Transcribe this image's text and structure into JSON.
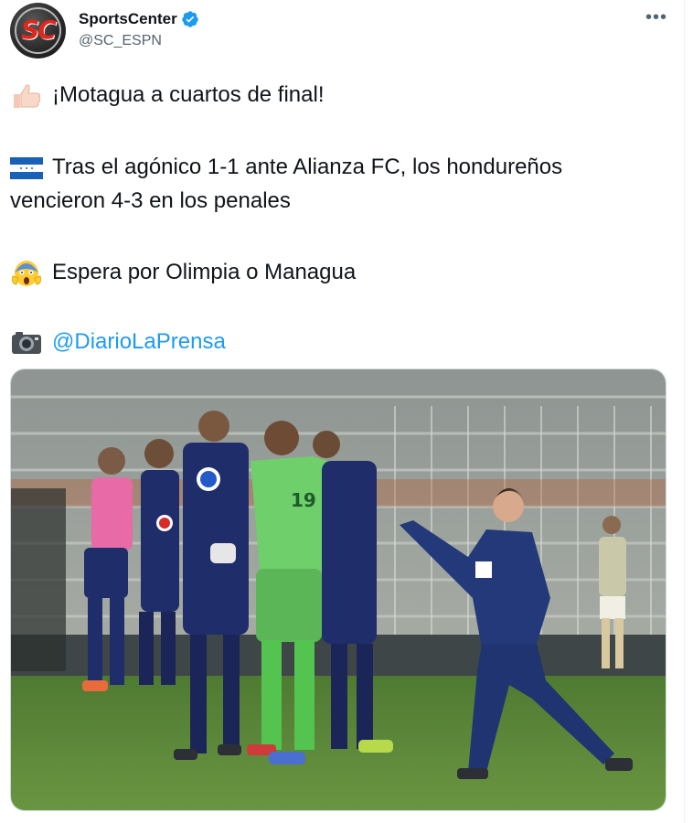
{
  "account": {
    "name": "SportsCenter",
    "handle": "@SC_ESPN",
    "avatar_text": "SC",
    "verified": true
  },
  "tweet": {
    "line1": "¡Motagua a cuartos de final!",
    "line2a": "Tras el agónico 1-1 ante Alianza FC, los hondureños",
    "line2b": "vencieron 4-3 en los penales",
    "line3": "Espera por Olimpia o Managua",
    "mention": "@DiarioLaPrensa",
    "emojis": [
      "thumbs-up-icon",
      "honduras-flag-icon",
      "screaming-face-icon",
      "camera-icon"
    ]
  },
  "colors": {
    "link": "#1d9bf0",
    "verified": "#1d9bf0",
    "pitch": "#5f8a3a",
    "kit": "#1f2d6b",
    "keeper": "#6fcf6a"
  }
}
